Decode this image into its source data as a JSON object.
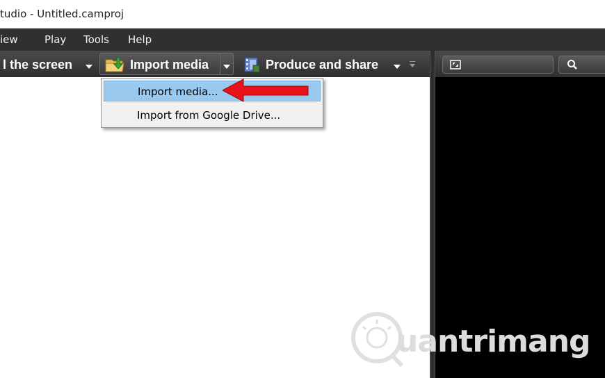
{
  "window": {
    "title": "tudio - Untitled.camproj"
  },
  "menubar": {
    "items": [
      "iew",
      "Play",
      "Tools",
      "Help"
    ]
  },
  "toolbar": {
    "record_label": "l the screen",
    "import_label": "Import media",
    "produce_label": "Produce and share"
  },
  "dropdown": {
    "items": [
      {
        "label": "Import media...",
        "highlighted": true
      },
      {
        "label": "Import from Google Drive...",
        "highlighted": false
      }
    ]
  },
  "watermark": {
    "text": "uantrimang"
  },
  "colors": {
    "menubar_bg": "#303030",
    "toolbar_bg": "#3c3c3c",
    "highlight": "#99c9ef",
    "annotation_arrow": "#e8121a",
    "preview_bg": "#000000"
  },
  "icons": [
    "folder-import-icon",
    "film-icon",
    "overflow-icon",
    "fit-preview-icon",
    "zoom-icon",
    "red-arrow-icon"
  ]
}
